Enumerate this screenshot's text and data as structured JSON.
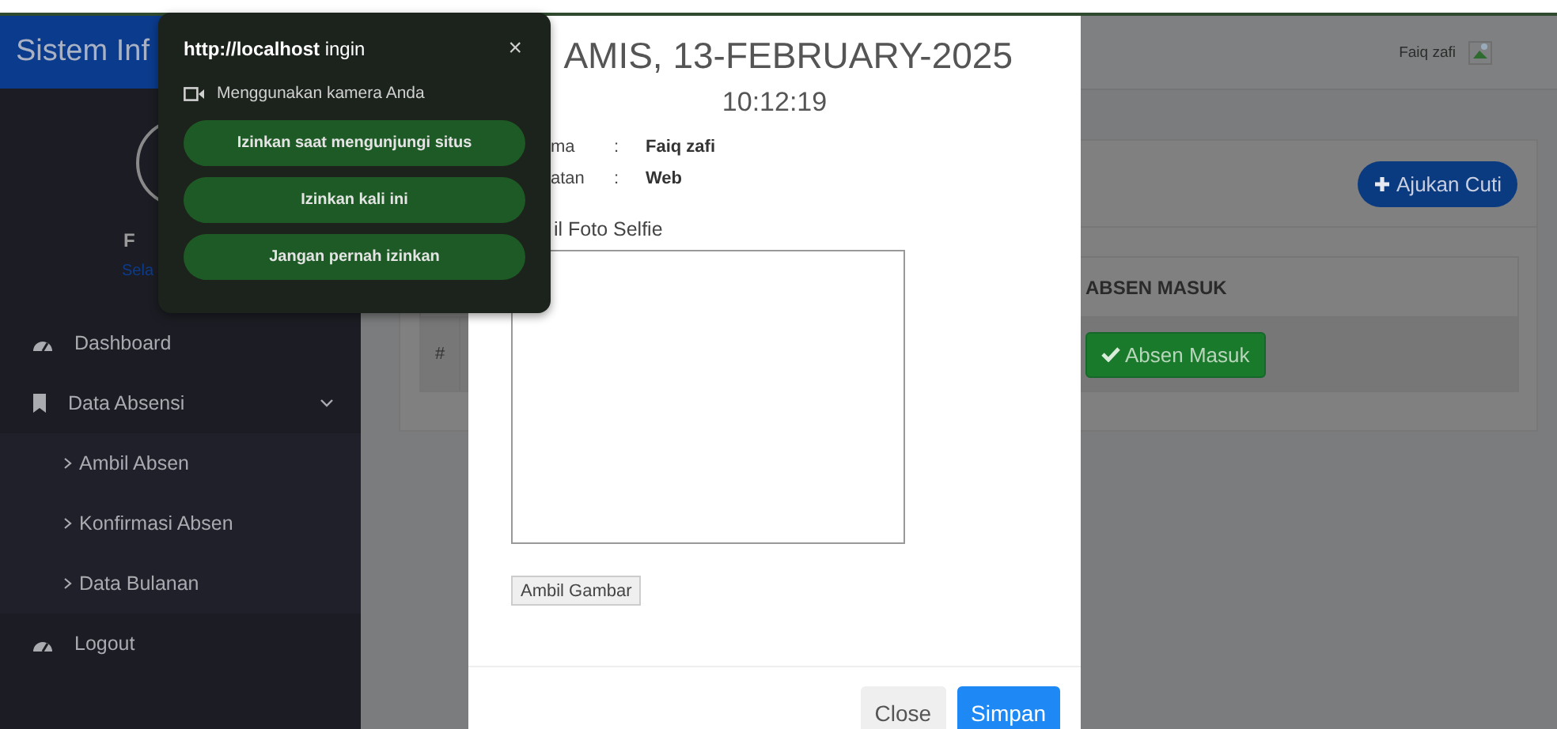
{
  "sidebar": {
    "brand": "Sistem Inf",
    "user_name": "F",
    "user_status": "Sela",
    "menu": [
      {
        "kind": "link",
        "label": "Dashboard"
      },
      {
        "kind": "group",
        "label": "Data Absensi",
        "expanded": true,
        "children": [
          {
            "label": "Ambil Absen"
          },
          {
            "label": "Konfirmasi Absen"
          },
          {
            "label": "Data Bulanan"
          }
        ]
      },
      {
        "kind": "link",
        "label": "Logout"
      }
    ]
  },
  "topbar": {
    "user_name": "Faiq zafi"
  },
  "card": {
    "action_button": "Ajukan Cuti",
    "table": {
      "column_header": "ABSEN MASUK",
      "row_header": "#",
      "row_button": "Absen Masuk"
    }
  },
  "modal": {
    "title": "AMIS, 13-FEBRUARY-2025",
    "time": "10:12:19",
    "fields": [
      {
        "label": "ma",
        "separator": ":",
        "value": "Faiq zafi"
      },
      {
        "label": "atan",
        "separator": ":",
        "value": "Web"
      }
    ],
    "camera_label": "il Foto Selfie",
    "capture_button": "Ambil Gambar",
    "buttons": [
      {
        "label": "Close",
        "kind": "secondary"
      },
      {
        "label": "Simpan",
        "kind": "primary"
      }
    ]
  },
  "permission_popup": {
    "title": "**http://localhost** ingin",
    "close": "×",
    "request": "Menggunakan kamera Anda",
    "options": [
      "Izinkan saat mengunjungi situs",
      "Izinkan kali ini",
      "Jangan pernah izinkan"
    ]
  }
}
